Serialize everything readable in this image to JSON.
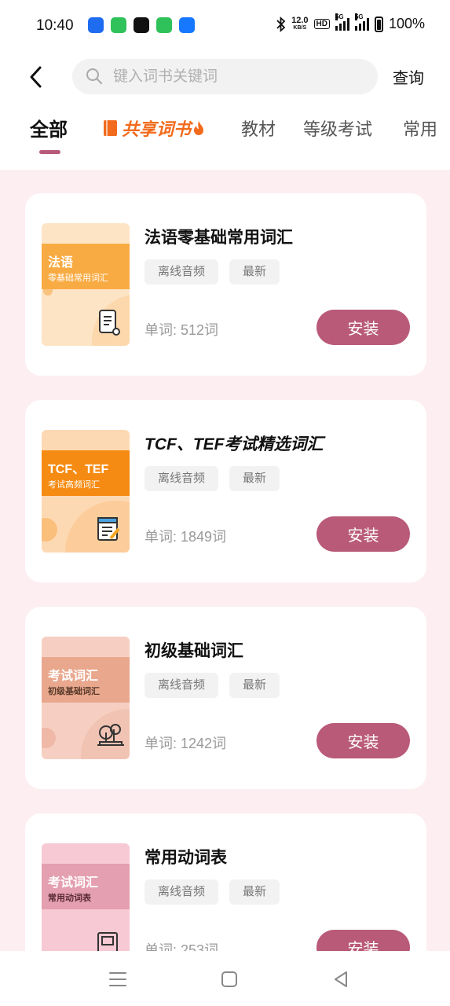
{
  "status_bar": {
    "time": "10:40",
    "net_speed_value": "12.0",
    "net_speed_unit": "KB/S",
    "hd": "HD",
    "signal1": "5G",
    "signal2": "5G",
    "battery": "100%",
    "app_icons": [
      "map-pin-app-icon",
      "wechat-mini-app-icon",
      "tiktok-app-icon",
      "messages-app-icon",
      "alipay-app-icon"
    ],
    "app_icon_colors": [
      "#1e6cf0",
      "#2fc25b",
      "#111111",
      "#2fc25b",
      "#1677ff"
    ]
  },
  "header": {
    "search_placeholder": "键入词书关键词",
    "query_label": "查询"
  },
  "tabs": [
    {
      "label": "全部",
      "active": true
    },
    {
      "label": "共享词书",
      "special": true
    },
    {
      "label": "教材"
    },
    {
      "label": "等级考试"
    },
    {
      "label": "常用"
    }
  ],
  "tag_labels": [
    "离线音频",
    "最新"
  ],
  "install_label": "安装",
  "books": [
    {
      "title": "法语零基础常用词汇",
      "cover_title": "法语",
      "cover_subtitle": "零基础常用词汇",
      "cover_bg": "#fde4c4",
      "cover_band": "#f9ab43",
      "cover_icon": "scroll-icon",
      "word_count": "单词: 512词"
    },
    {
      "title": "TCF、TEF考试精选词汇",
      "cover_title": "TCF、TEF",
      "cover_subtitle": "考试高频词汇",
      "cover_bg": "#fdd9b3",
      "cover_band": "#f68b13",
      "cover_icon": "notepad-icon",
      "word_count": "单词: 1849词"
    },
    {
      "title": "初级基础词汇",
      "cover_title": "考试词汇",
      "cover_subtitle": "初级基础词汇",
      "cover_bg": "#f6cfc2",
      "cover_band": "#e9a88e",
      "cover_icon": "book-tree-icon",
      "word_count": "单词: 1242词"
    },
    {
      "title": "常用动词表",
      "cover_title": "考试词汇",
      "cover_subtitle": "常用动词表",
      "cover_bg": "#f6c9d4",
      "cover_band": "#e49fb0",
      "cover_icon": "book-icon",
      "word_count": "单词: 253词"
    }
  ],
  "colors": {
    "accent": "#b95a78",
    "shared_tab": "#f26b1d",
    "background": "#fdeef1"
  },
  "nav_bar": [
    "menu-icon",
    "home-icon",
    "back-triangle-icon"
  ]
}
